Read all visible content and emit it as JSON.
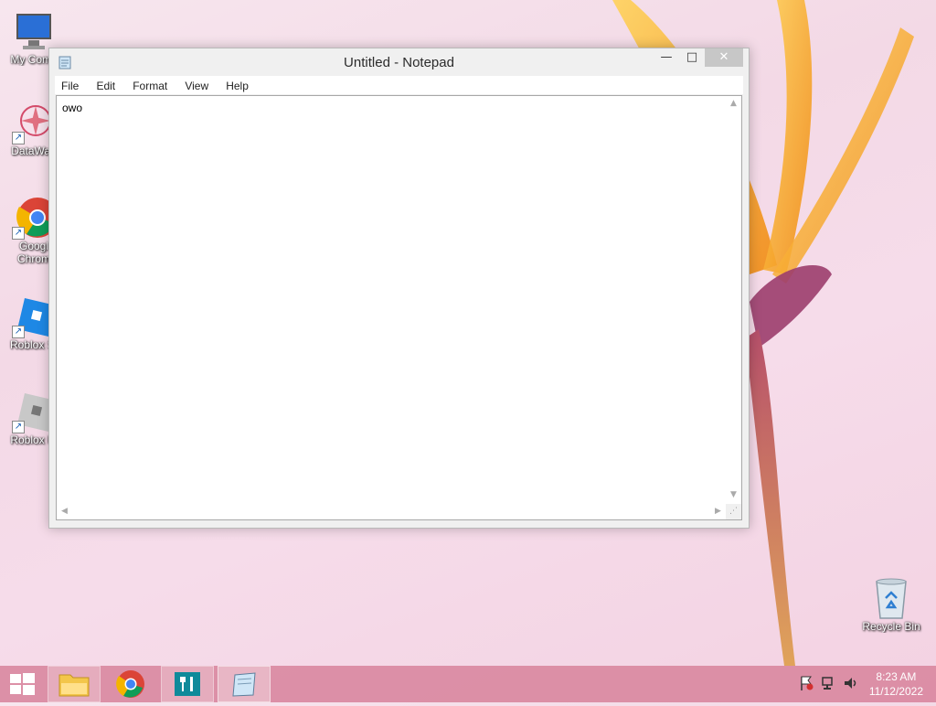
{
  "desktop": {
    "icons": [
      {
        "label": "My Comp"
      },
      {
        "label": "DataWag"
      },
      {
        "label": "Googl\nChrom"
      },
      {
        "label": "Roblox St"
      },
      {
        "label": "Roblox Pl"
      }
    ],
    "recycle_bin": {
      "label": "Recycle Bin"
    }
  },
  "notepad": {
    "title": "Untitled - Notepad",
    "controls": {
      "minimize": "—",
      "maximize": "□",
      "close": "✕"
    },
    "menu": [
      "File",
      "Edit",
      "Format",
      "View",
      "Help"
    ],
    "content": "owo"
  },
  "taskbar": {
    "items": [
      "start",
      "file-explorer",
      "google-chrome",
      "app",
      "notepad"
    ],
    "clock": {
      "time": "8:23 AM",
      "date": "11/12/2022"
    }
  },
  "colors": {
    "taskbar": "#d7829b",
    "accent_orange": "#f5a21c",
    "close_button": "#c7c7c7"
  }
}
